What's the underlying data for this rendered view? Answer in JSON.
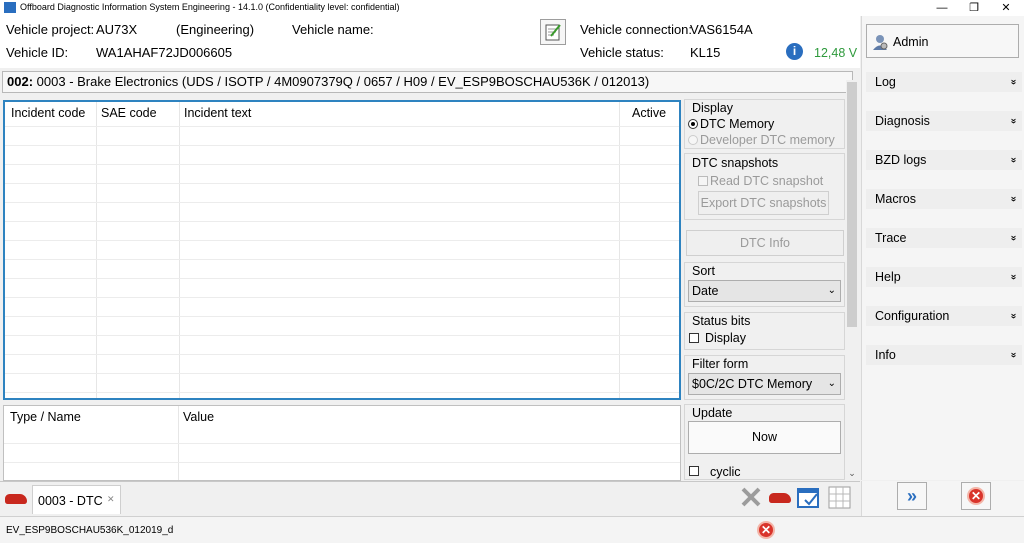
{
  "window": {
    "title": "Offboard Diagnostic Information System Engineering - 14.1.0 (Confidentiality level: confidential)",
    "min": "—",
    "max": "❐",
    "close": "✕"
  },
  "vehicle": {
    "project_label": "Vehicle project:",
    "project_value": "AU73X",
    "project_mode": "(Engineering)",
    "name_label": "Vehicle name:",
    "id_label": "Vehicle ID:",
    "id_value": "WA1AHAF72JD006605",
    "connection_label": "Vehicle connection:",
    "connection_value": "VAS6154A",
    "status_label": "Vehicle status:",
    "status_value": "KL15",
    "voltage": "12,48 V",
    "voltage_color": "#2e9a3c"
  },
  "ecu": {
    "address": "002:",
    "description": "0003 - Brake Electronics  (UDS / ISOTP / 4M0907379Q / 0657 / H09 / EV_ESP9BOSCHAU536K / 012013)"
  },
  "dtc_table": {
    "columns": [
      "Incident code",
      "SAE code",
      "Incident text",
      "Active"
    ],
    "rows": []
  },
  "detail_table": {
    "columns": [
      "Type / Name",
      "Value"
    ],
    "rows": []
  },
  "options": {
    "display_label": "Display",
    "dtc_memory": "DTC Memory",
    "developer_dtc": "Developer DTC memory",
    "snapshots_label": "DTC snapshots",
    "read_snapshot": "Read DTC snapshot",
    "export_snapshots": "Export DTC snapshots",
    "dtc_info": "DTC Info",
    "sort_label": "Sort",
    "sort_value": "Date",
    "status_bits_label": "Status bits",
    "status_display": "Display",
    "filter_label": "Filter form",
    "filter_value": "$0C/2C DTC Memory",
    "update_label": "Update",
    "now": "Now",
    "cyclic": "cyclic"
  },
  "sidebar": {
    "user": "Admin",
    "items": [
      {
        "label": "Log"
      },
      {
        "label": "Diagnosis"
      },
      {
        "label": "BZD logs"
      },
      {
        "label": "Macros"
      },
      {
        "label": "Trace"
      },
      {
        "label": "Help"
      },
      {
        "label": "Configuration"
      },
      {
        "label": "Info"
      }
    ],
    "chevron": "»"
  },
  "tabs": {
    "active_tab": "0003 - DTC",
    "tab_close": "✕"
  },
  "status": {
    "text": "EV_ESP9BOSCHAU536K_012019_d"
  },
  "colors": {
    "accent_blue": "#2e83c0",
    "error_red": "#d9342b"
  }
}
